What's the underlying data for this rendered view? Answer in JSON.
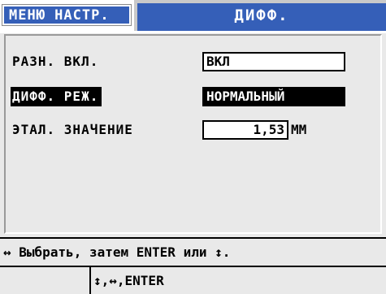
{
  "header": {
    "menu_tab_label": "МЕНЮ НАСТР.",
    "active_tab_label": "ДИФФ."
  },
  "settings": [
    {
      "label": "РАЗН. ВКЛ.",
      "value": "ВКЛ",
      "selected": false
    },
    {
      "label": "ДИФФ. РЕЖ.",
      "value": "НОРМАЛЬНЫЙ",
      "selected": true
    },
    {
      "label": "ЭТАЛ. ЗНАЧЕНИЕ",
      "value": "1,53",
      "unit": "ММ",
      "selected": false
    }
  ],
  "help": {
    "left_arrow_icon": "left-right-arrow-icon",
    "text": "Выбрать, затем ENTER или",
    "up_down_icon": "up-down-arrow-icon",
    "end": "."
  },
  "status": {
    "keys": "↕,↔,ENTER"
  },
  "colors": {
    "tab_blue": "#355fb8",
    "background": "#e9e9e9",
    "selected_bg": "#000000"
  }
}
